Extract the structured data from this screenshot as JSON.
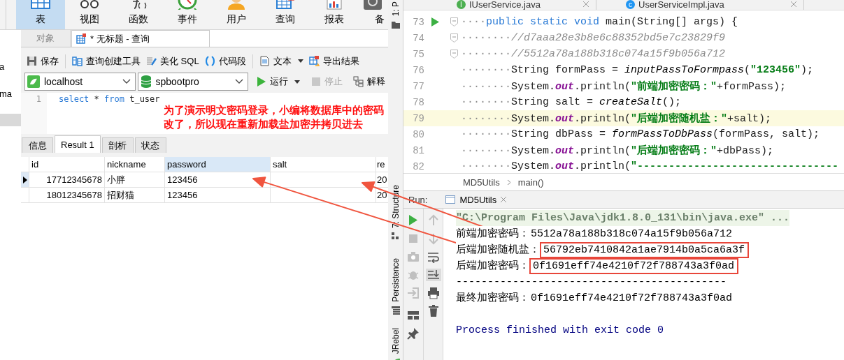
{
  "navicat": {
    "ribbon": [
      {
        "label": "表",
        "selected": true
      },
      {
        "label": "视图",
        "selected": false
      },
      {
        "label": "函数",
        "selected": false
      },
      {
        "label": "事件",
        "selected": false
      },
      {
        "label": "用户",
        "selected": false
      },
      {
        "label": "查询",
        "selected": false
      },
      {
        "label": "报表",
        "selected": false
      },
      {
        "label": "备",
        "selected": false
      }
    ],
    "sidebar": [
      {
        "label": "a"
      },
      {
        "label": "ma"
      }
    ],
    "tabs": [
      {
        "label": "对象",
        "selected": false
      },
      {
        "label": "* 无标题 - 查询",
        "selected": true
      }
    ],
    "toolbar": [
      {
        "kind": "button",
        "label": "保存"
      },
      {
        "kind": "separator"
      },
      {
        "kind": "button",
        "label": "查询创建工具"
      },
      {
        "kind": "button",
        "label": "美化 SQL"
      },
      {
        "kind": "button",
        "label": "代码段"
      },
      {
        "kind": "separator"
      },
      {
        "kind": "dropdown",
        "label": "文本"
      },
      {
        "kind": "button",
        "label": "导出结果"
      }
    ],
    "connection": "localhost",
    "database": "spbootpro",
    "actions": [
      {
        "kind": "dropdown",
        "label": "运行",
        "disabled": false
      },
      {
        "kind": "button",
        "label": "停止",
        "disabled": true
      },
      {
        "kind": "button",
        "label": "解释",
        "disabled": false
      }
    ],
    "editor": [
      {
        "number": "1",
        "tokens": [
          {
            "kind": "keyword",
            "text": "select"
          },
          {
            "kind": "plain",
            "text": " * "
          },
          {
            "kind": "keyword",
            "text": "from"
          },
          {
            "kind": "plain",
            "text": " t_user"
          }
        ]
      }
    ],
    "result_tabs": [
      {
        "label": "信息",
        "selected": false
      },
      {
        "label": "Result 1",
        "selected": true
      },
      {
        "label": "剖析",
        "selected": false
      },
      {
        "label": "状态",
        "selected": false
      }
    ],
    "table": {
      "columns": [
        {
          "label": "id",
          "selected": false
        },
        {
          "label": "nickname",
          "selected": false
        },
        {
          "label": "password",
          "selected": true
        },
        {
          "label": "salt",
          "selected": false
        },
        {
          "label": "re",
          "selected": false
        }
      ],
      "rows": [
        {
          "selected": true,
          "cells": [
            "17712345678",
            "小胖",
            "123456",
            null,
            "20"
          ]
        },
        {
          "selected": false,
          "cells": [
            "18012345678",
            "招财猫",
            "123456",
            null,
            "20"
          ]
        }
      ]
    }
  },
  "idea": {
    "tool_windows": [
      {
        "label": "1: P"
      },
      {
        "label": "7: Structure"
      },
      {
        "label": "Persistence"
      },
      {
        "label": "JRebel"
      }
    ],
    "editor_tabs": [
      {
        "badge": "I",
        "label": "IUserService.java"
      },
      {
        "badge": "c",
        "label": "UserServiceImpl.java"
      }
    ],
    "code": [
      {
        "number": "73",
        "run": true,
        "fold": true,
        "highlighted": false,
        "tokens": [
          {
            "kind": "ws",
            "text": "····"
          },
          {
            "kind": "keyword",
            "text": "public "
          },
          {
            "kind": "keyword",
            "text": "static "
          },
          {
            "kind": "keyword",
            "text": "void "
          },
          {
            "kind": "plain",
            "text": "main(String[] args) {"
          }
        ]
      },
      {
        "number": "74",
        "run": false,
        "fold": true,
        "highlighted": false,
        "tokens": [
          {
            "kind": "ws",
            "text": "········"
          },
          {
            "kind": "comment",
            "text": "//d7aaa28e3b8e6c88352bd5e7c23829f9"
          }
        ]
      },
      {
        "number": "75",
        "run": false,
        "fold": true,
        "highlighted": false,
        "tokens": [
          {
            "kind": "ws",
            "text": "········"
          },
          {
            "kind": "comment",
            "text": "//5512a78a188b318c074a15f9b056a712"
          }
        ]
      },
      {
        "number": "76",
        "run": false,
        "fold": false,
        "highlighted": false,
        "tokens": [
          {
            "kind": "ws",
            "text": "········"
          },
          {
            "kind": "plain",
            "text": "String formPass = "
          },
          {
            "kind": "call",
            "text": "inputPassToFormpass"
          },
          {
            "kind": "plain",
            "text": "("
          },
          {
            "kind": "string",
            "text": "\"123456\""
          },
          {
            "kind": "plain",
            "text": ");"
          }
        ]
      },
      {
        "number": "77",
        "run": false,
        "fold": false,
        "highlighted": false,
        "tokens": [
          {
            "kind": "ws",
            "text": "········"
          },
          {
            "kind": "plain",
            "text": "System."
          },
          {
            "kind": "field",
            "text": "out"
          },
          {
            "kind": "plain",
            "text": ".println("
          },
          {
            "kind": "string",
            "text": "\"前端加密密码：\""
          },
          {
            "kind": "plain",
            "text": "+formPass);"
          }
        ]
      },
      {
        "number": "78",
        "run": false,
        "fold": false,
        "highlighted": false,
        "tokens": [
          {
            "kind": "ws",
            "text": "········"
          },
          {
            "kind": "plain",
            "text": "String salt = "
          },
          {
            "kind": "call",
            "text": "createSalt"
          },
          {
            "kind": "plain",
            "text": "();"
          }
        ]
      },
      {
        "number": "79",
        "run": false,
        "fold": false,
        "highlighted": true,
        "tokens": [
          {
            "kind": "ws",
            "text": "········"
          },
          {
            "kind": "plain",
            "text": "System."
          },
          {
            "kind": "field",
            "text": "out"
          },
          {
            "kind": "plain",
            "text": ".println("
          },
          {
            "kind": "string",
            "text": "\"后端加密随机盐：\""
          },
          {
            "kind": "plain",
            "text": "+salt);"
          }
        ]
      },
      {
        "number": "80",
        "run": false,
        "fold": false,
        "highlighted": false,
        "tokens": [
          {
            "kind": "ws",
            "text": "········"
          },
          {
            "kind": "plain",
            "text": "String dbPass = "
          },
          {
            "kind": "call",
            "text": "formPassToDbPass"
          },
          {
            "kind": "plain",
            "text": "(formPass, salt);"
          }
        ]
      },
      {
        "number": "81",
        "run": false,
        "fold": false,
        "highlighted": false,
        "tokens": [
          {
            "kind": "ws",
            "text": "········"
          },
          {
            "kind": "plain",
            "text": "System."
          },
          {
            "kind": "field",
            "text": "out"
          },
          {
            "kind": "plain",
            "text": ".println("
          },
          {
            "kind": "string",
            "text": "\"后端加密密码：\""
          },
          {
            "kind": "plain",
            "text": "+dbPass);"
          }
        ]
      },
      {
        "number": "82",
        "run": false,
        "fold": false,
        "highlighted": false,
        "tokens": [
          {
            "kind": "ws",
            "text": "········"
          },
          {
            "kind": "plain",
            "text": "System."
          },
          {
            "kind": "field",
            "text": "out"
          },
          {
            "kind": "plain",
            "text": ".println("
          },
          {
            "kind": "string",
            "text": "\"--------------------------------"
          }
        ]
      }
    ],
    "breadcrumb": [
      "MD5Utils",
      "main()"
    ],
    "run": {
      "label": "Run:",
      "tab": "MD5Utils"
    },
    "console": [
      {
        "kind": "command",
        "text": "\"C:\\Program Files\\Java\\jdk1.8.0_131\\bin\\java.exe\" ..."
      },
      {
        "kind": "pair",
        "label": "前端加密密码：",
        "value": "5512a78a188b318c074a15f9b056a712",
        "boxed": false
      },
      {
        "kind": "pair",
        "label": "后端加密随机盐：",
        "value": "56792eb7410842a1ae7914b0a5ca6a3f",
        "boxed": true
      },
      {
        "kind": "pair",
        "label": "后端加密密码：",
        "value": "0f1691eff74e4210f72f788743a3f0ad",
        "boxed": true
      },
      {
        "kind": "output",
        "text": "-------------------------------------------"
      },
      {
        "kind": "pair",
        "label": "最终加密密码：",
        "value": "0f1691eff74e4210f72f788743a3f0ad",
        "boxed": false
      },
      {
        "kind": "exit",
        "text": "Process finished with exit code 0"
      }
    ]
  },
  "annotation": {
    "text": "为了演示明文密码登录，小编将数据库中的密码改了，所以现在重新加载盐加密并拷贝进去"
  }
}
